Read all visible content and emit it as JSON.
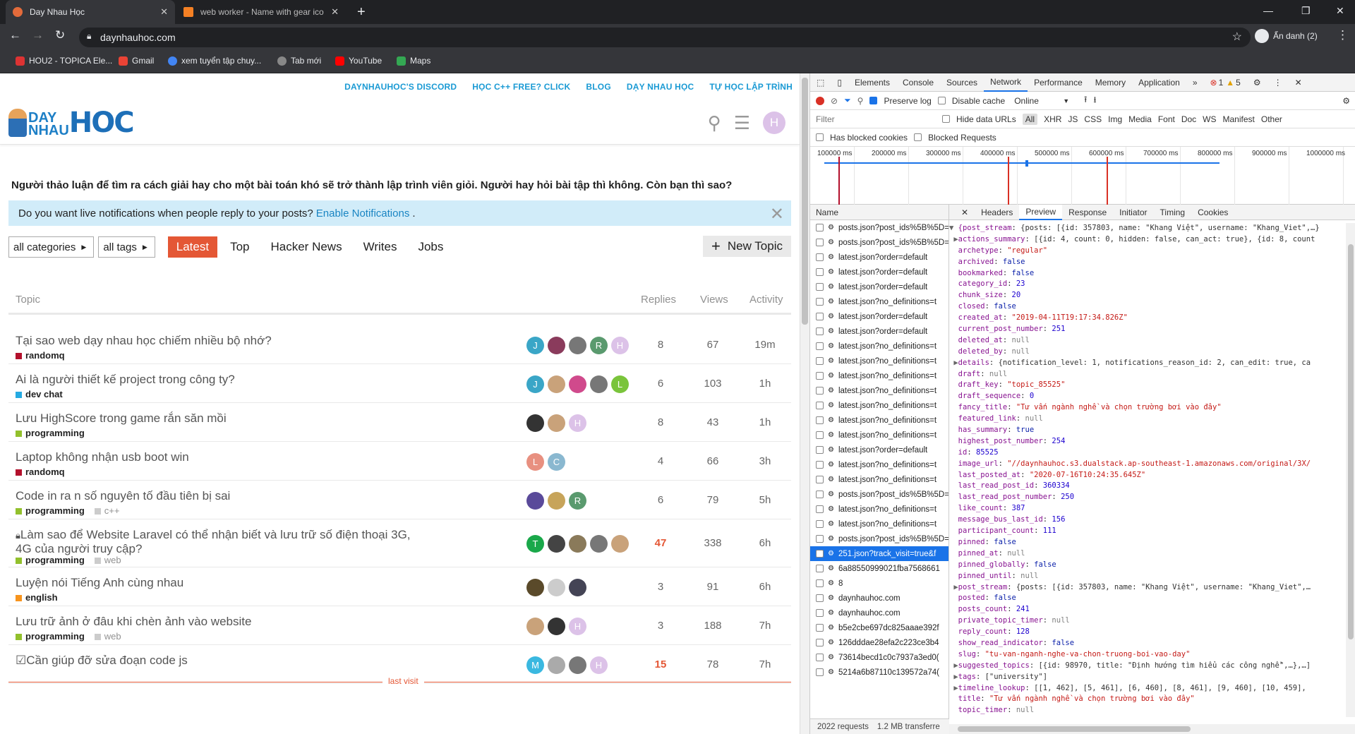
{
  "browser": {
    "tabs": [
      {
        "title": "Day Nhau Học",
        "color": "#e36b3b"
      },
      {
        "title": "web worker - Name with gear ico",
        "color": "#f48024"
      }
    ],
    "url": "daynhauhoc.com",
    "profile": "Ẩn danh (2)",
    "bookmarks": [
      {
        "label": "HOU2 - TOPICA Ele...",
        "color": "#d33"
      },
      {
        "label": "Gmail",
        "color": "#ea4335"
      },
      {
        "label": "xem tuyển tập chuy...",
        "color": "#4285f4"
      },
      {
        "label": "Tab mới",
        "color": "#888"
      },
      {
        "label": "YouTube",
        "color": "#f00"
      },
      {
        "label": "Maps",
        "color": "#34a853"
      }
    ]
  },
  "site": {
    "top_links": [
      "DAYNHAUHOC'S DISCORD",
      "HỌC C++ FREE? CLICK",
      "BLOG",
      "DẠY NHAU HỌC",
      "TỰ HỌC LẬP TRÌNH"
    ],
    "logo_small": "DAY\nNHAU",
    "logo_big": "HOC",
    "user_initial": "H",
    "banner": "Người thảo luận để tìm ra cách giải hay cho một bài toán khó sẽ trở thành lập trình viên giỏi. Người hay hỏi bài tập thì không. Còn bạn thì sao?",
    "notification": "Do you want live notifications when people reply to your posts?",
    "notification_link": "Enable Notifications",
    "notification_end": ".",
    "filter_categories": "all categories",
    "filter_tags": "all tags",
    "nav": [
      "Latest",
      "Top",
      "Hacker News",
      "Writes",
      "Jobs"
    ],
    "new_topic": "New Topic",
    "columns": {
      "topic": "Topic",
      "replies": "Replies",
      "views": "Views",
      "activity": "Activity"
    },
    "last_visit": "last visit",
    "topics": [
      {
        "title": "Tại sao web dạy nhau học chiếm nhiều bộ nhớ?",
        "category": "randomq",
        "cat_color": "#b3102c",
        "tags": [],
        "replies": "8",
        "views": "67",
        "activity": "19m",
        "hot": false,
        "posters": [
          [
            "J",
            "#3aa6c7"
          ],
          [
            "",
            "#8a3b5c"
          ],
          [
            "",
            "#777"
          ],
          [
            "R",
            "#5a9a6e"
          ],
          [
            "H",
            "#dcc2e8"
          ]
        ]
      },
      {
        "title": "Ai là người thiết kế project trong công ty?",
        "category": "dev chat",
        "cat_color": "#25aae2",
        "tags": [],
        "replies": "6",
        "views": "103",
        "activity": "1h",
        "hot": false,
        "posters": [
          [
            "J",
            "#3aa6c7"
          ],
          [
            "",
            "#c9a27a"
          ],
          [
            "",
            "#d04a8c"
          ],
          [
            "",
            "#777"
          ],
          [
            "L",
            "#7ac43b"
          ]
        ]
      },
      {
        "title": "Lưu HighScore trong game rắn săn mồi",
        "category": "programming",
        "cat_color": "#92c02c",
        "tags": [],
        "replies": "8",
        "views": "43",
        "activity": "1h",
        "hot": false,
        "posters": [
          [
            "",
            "#333"
          ],
          [
            "",
            "#c9a27a"
          ],
          [
            "H",
            "#dcc2e8"
          ]
        ]
      },
      {
        "title": "Laptop không nhận usb boot win",
        "category": "randomq",
        "cat_color": "#b3102c",
        "tags": [],
        "replies": "4",
        "views": "66",
        "activity": "3h",
        "hot": false,
        "posters": [
          [
            "L",
            "#e89080"
          ],
          [
            "C",
            "#8ab8d0"
          ]
        ]
      },
      {
        "title": "Code in ra n số nguyên tố đầu tiên bị sai",
        "category": "programming",
        "cat_color": "#92c02c",
        "tags": [
          "c++"
        ],
        "replies": "6",
        "views": "79",
        "activity": "5h",
        "hot": false,
        "posters": [
          [
            "",
            "#5a4a9a"
          ],
          [
            "",
            "#c7a45a"
          ],
          [
            "R",
            "#5a9a6e"
          ]
        ]
      },
      {
        "title": "Làm sao để Website Laravel có thể nhận biết và lưu trữ số điện thoại 3G, 4G của người truy cập?",
        "category": "programming",
        "cat_color": "#92c02c",
        "tags": [
          "web"
        ],
        "replies": "47",
        "views": "338",
        "activity": "6h",
        "hot": true,
        "locked": true,
        "posters": [
          [
            "T",
            "#1aa84a"
          ],
          [
            "",
            "#444"
          ],
          [
            "",
            "#8a7a5a"
          ],
          [
            "",
            "#777"
          ],
          [
            "",
            "#c9a27a"
          ]
        ]
      },
      {
        "title": "Luyện nói Tiếng Anh cùng nhau",
        "category": "english",
        "cat_color": "#f7941d",
        "tags": [],
        "replies": "3",
        "views": "91",
        "activity": "6h",
        "hot": false,
        "posters": [
          [
            "",
            "#5a4a2a"
          ],
          [
            "",
            "#ccc"
          ],
          [
            "",
            "#445"
          ]
        ]
      },
      {
        "title": "Lưu trữ ảnh ở đâu khi chèn ảnh vào website",
        "category": "programming",
        "cat_color": "#92c02c",
        "tags": [
          "web"
        ],
        "replies": "3",
        "views": "188",
        "activity": "7h",
        "hot": false,
        "posters": [
          [
            "",
            "#c9a27a"
          ],
          [
            "",
            "#333"
          ],
          [
            "H",
            "#dcc2e8"
          ]
        ]
      },
      {
        "title": "Cần giúp đỡ sửa đoạn code js",
        "category": "",
        "cat_color": "#92c02c",
        "tags": [],
        "replies": "15",
        "views": "78",
        "activity": "7h",
        "hot": true,
        "solved": true,
        "posters": [
          [
            "M",
            "#3ab8e0"
          ],
          [
            "",
            "#aaa"
          ],
          [
            "",
            "#777"
          ],
          [
            "H",
            "#dcc2e8"
          ]
        ]
      }
    ]
  },
  "devtools": {
    "tabs": [
      "Elements",
      "Console",
      "Sources",
      "Network",
      "Performance",
      "Memory",
      "Application",
      "»"
    ],
    "errors": "1",
    "warnings": "5",
    "preserve_log": "Preserve log",
    "disable_cache": "Disable cache",
    "throttle": "Online",
    "filter_placeholder": "Filter",
    "hide_data_urls": "Hide data URLs",
    "types": [
      "All",
      "XHR",
      "JS",
      "CSS",
      "Img",
      "Media",
      "Font",
      "Doc",
      "WS",
      "Manifest",
      "Other"
    ],
    "blocked_cookies": "Has blocked cookies",
    "blocked_requests": "Blocked Requests",
    "timeline_ticks": [
      "100000 ms",
      "200000 ms",
      "300000 ms",
      "400000 ms",
      "500000 ms",
      "600000 ms",
      "700000 ms",
      "800000 ms",
      "900000 ms",
      "1000000 ms"
    ],
    "name_header": "Name",
    "requests": [
      "posts.json?post_ids%5B%5D=",
      "posts.json?post_ids%5B%5D=",
      "latest.json?order=default",
      "latest.json?order=default",
      "latest.json?order=default",
      "latest.json?no_definitions=t",
      "latest.json?order=default",
      "latest.json?order=default",
      "latest.json?no_definitions=t",
      "latest.json?no_definitions=t",
      "latest.json?no_definitions=t",
      "latest.json?no_definitions=t",
      "latest.json?no_definitions=t",
      "latest.json?no_definitions=t",
      "latest.json?no_definitions=t",
      "latest.json?order=default",
      "latest.json?no_definitions=t",
      "latest.json?no_definitions=t",
      "posts.json?post_ids%5B%5D=",
      "latest.json?no_definitions=t",
      "latest.json?no_definitions=t",
      "posts.json?post_ids%5B%5D=",
      "251.json?track_visit=true&f",
      "6a88550999021fba7568661",
      "8",
      "daynhauhoc.com",
      "daynhauhoc.com",
      "b5e2cbe697dc825aaae392f",
      "126dddae28efa2c223ce3b4",
      "73614becd1c0c7937a3ed0(",
      "5214a6b87110c139572a74("
    ],
    "selected_index": 22,
    "footer_requests": "2022 requests",
    "footer_transfer": "1.2 MB transferre",
    "detail_tabs": [
      "Headers",
      "Preview",
      "Response",
      "Initiator",
      "Timing",
      "Cookies"
    ],
    "json_lines": [
      {
        "t": "▼ ",
        "k": "{post_stream",
        "v": ": {posts: [{id: 357803, name: \"Khang Việt\", username: \"Khang_Viet\",…}",
        "c": ""
      },
      {
        "t": " ▶",
        "k": "actions_summary",
        "v": ": [{id: 4, count: 0, hidden: false, can_act: true}, {id: 8, count",
        "c": ""
      },
      {
        "t": "  ",
        "k": "archetype",
        "v": "\"regular\"",
        "c": "s"
      },
      {
        "t": "  ",
        "k": "archived",
        "v": "false",
        "c": "b"
      },
      {
        "t": "  ",
        "k": "bookmarked",
        "v": "false",
        "c": "b"
      },
      {
        "t": "  ",
        "k": "category_id",
        "v": "23",
        "c": "n"
      },
      {
        "t": "  ",
        "k": "chunk_size",
        "v": "20",
        "c": "n"
      },
      {
        "t": "  ",
        "k": "closed",
        "v": "false",
        "c": "b"
      },
      {
        "t": "  ",
        "k": "created_at",
        "v": "\"2019-04-11T19:17:34.826Z\"",
        "c": "s"
      },
      {
        "t": "  ",
        "k": "current_post_number",
        "v": "251",
        "c": "n"
      },
      {
        "t": "  ",
        "k": "deleted_at",
        "v": "null",
        "c": "nl"
      },
      {
        "t": "  ",
        "k": "deleted_by",
        "v": "null",
        "c": "nl"
      },
      {
        "t": " ▶",
        "k": "details",
        "v": ": {notification_level: 1, notifications_reason_id: 2, can_edit: true, ca",
        "c": ""
      },
      {
        "t": "  ",
        "k": "draft",
        "v": "null",
        "c": "nl"
      },
      {
        "t": "  ",
        "k": "draft_key",
        "v": "\"topic_85525\"",
        "c": "s"
      },
      {
        "t": "  ",
        "k": "draft_sequence",
        "v": "0",
        "c": "n"
      },
      {
        "t": "  ",
        "k": "fancy_title",
        "v": "\"Tư vấn ngành nghề và chọn trường bơi vào đây\"",
        "c": "s"
      },
      {
        "t": "  ",
        "k": "featured_link",
        "v": "null",
        "c": "nl"
      },
      {
        "t": "  ",
        "k": "has_summary",
        "v": "true",
        "c": "b"
      },
      {
        "t": "  ",
        "k": "highest_post_number",
        "v": "254",
        "c": "n"
      },
      {
        "t": "  ",
        "k": "id",
        "v": "85525",
        "c": "n"
      },
      {
        "t": "  ",
        "k": "image_url",
        "v": "\"//daynhauhoc.s3.dualstack.ap-southeast-1.amazonaws.com/original/3X/",
        "c": "s"
      },
      {
        "t": "  ",
        "k": "last_posted_at",
        "v": "\"2020-07-16T10:24:35.645Z\"",
        "c": "s"
      },
      {
        "t": "  ",
        "k": "last_read_post_id",
        "v": "360334",
        "c": "n"
      },
      {
        "t": "  ",
        "k": "last_read_post_number",
        "v": "250",
        "c": "n"
      },
      {
        "t": "  ",
        "k": "like_count",
        "v": "387",
        "c": "n"
      },
      {
        "t": "  ",
        "k": "message_bus_last_id",
        "v": "156",
        "c": "n"
      },
      {
        "t": "  ",
        "k": "participant_count",
        "v": "111",
        "c": "n"
      },
      {
        "t": "  ",
        "k": "pinned",
        "v": "false",
        "c": "b"
      },
      {
        "t": "  ",
        "k": "pinned_at",
        "v": "null",
        "c": "nl"
      },
      {
        "t": "  ",
        "k": "pinned_globally",
        "v": "false",
        "c": "b"
      },
      {
        "t": "  ",
        "k": "pinned_until",
        "v": "null",
        "c": "nl"
      },
      {
        "t": " ▶",
        "k": "post_stream",
        "v": ": {posts: [{id: 357803, name: \"Khang Việt\", username: \"Khang_Viet\",…",
        "c": ""
      },
      {
        "t": "  ",
        "k": "posted",
        "v": "false",
        "c": "b"
      },
      {
        "t": "  ",
        "k": "posts_count",
        "v": "241",
        "c": "n"
      },
      {
        "t": "  ",
        "k": "private_topic_timer",
        "v": "null",
        "c": "nl"
      },
      {
        "t": "  ",
        "k": "reply_count",
        "v": "128",
        "c": "n"
      },
      {
        "t": "  ",
        "k": "show_read_indicator",
        "v": "false",
        "c": "b"
      },
      {
        "t": "  ",
        "k": "slug",
        "v": "\"tu-van-nganh-nghe-va-chon-truong-boi-vao-day\"",
        "c": "s"
      },
      {
        "t": " ▶",
        "k": "suggested_topics",
        "v": ": [{id: 98970, title: \"Định hướng tìm hiểu các công nghề\",…},…]",
        "c": ""
      },
      {
        "t": " ▶",
        "k": "tags",
        "v": ": [\"university\"]",
        "c": ""
      },
      {
        "t": " ▶",
        "k": "timeline_lookup",
        "v": ": [[1, 462], [5, 461], [6, 460], [8, 461], [9, 460], [10, 459],",
        "c": ""
      },
      {
        "t": "  ",
        "k": "title",
        "v": "\"Tư vấn ngành nghề và chọn trường bơi vào đây\"",
        "c": "s"
      },
      {
        "t": "  ",
        "k": "topic_timer",
        "v": "null",
        "c": "nl"
      }
    ]
  }
}
